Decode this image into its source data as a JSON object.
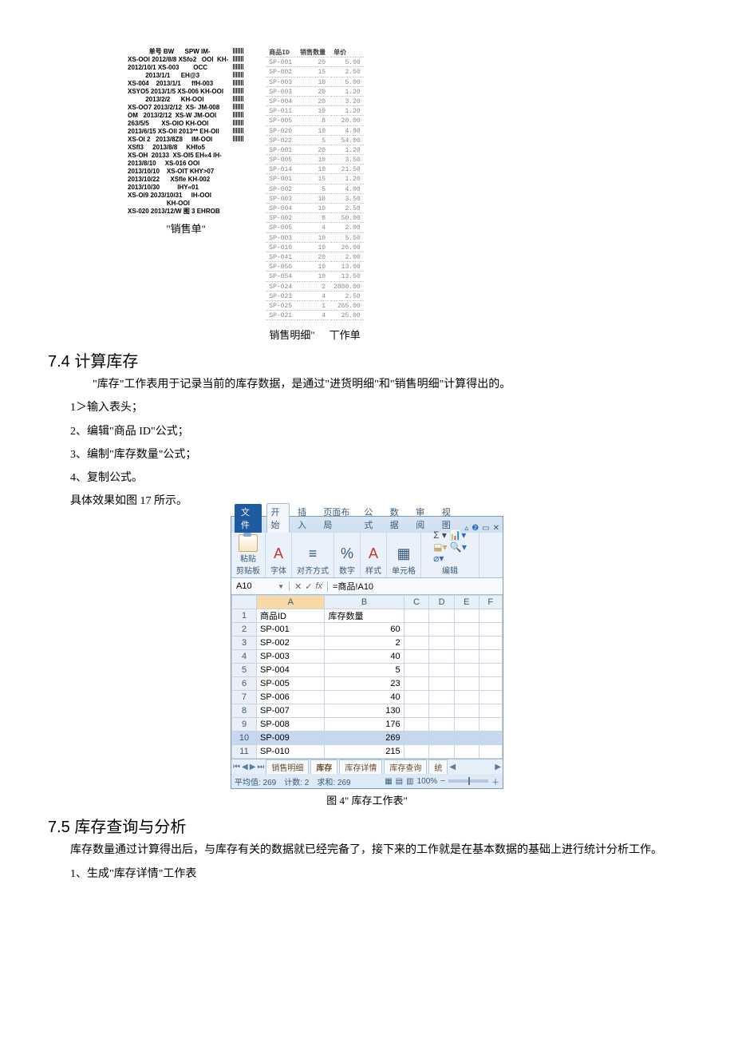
{
  "figures": {
    "sales_order_caption": "\"销售单\"",
    "sales_detail_caption": "销售明细\"",
    "t_zuodan": "丅作单",
    "sales_order_text": "            单号 BW      SPW IM-\nXS-OOl 2012/8/8 XSfo2   OOl  KH-\n2012/10/1 XS-003        OCC\n          2013/1/1      EH@3\nXS-004    2013/1/1      ffH-003\nXSYO5 2013/1/5 XS-006 KH-OOl\n          2013/2/2      KH-OOl\nXS-OO7 2013/2/12  XS- JM-008\nOM   2013/2/12  XS-W JM-OOl\n263/5/5       XS-OlO KH-OOl\n2013/6/15 XS-Oll 2013** EH-Oll\nXS-OI 2   2013/8Z8     IM-OOl\nXSfl3     2013/8/8     KHfo5\nXS-OH  20133  XS-OI5 EH«4 IH-\n2013/8/10     XS-016 OOl\n2013/10/10    XS-OIT KHY>07\n2013/10/22      XSfle KH-002\n2013/10/30          lHY«01\nXS-Ol9 20J3/10/31     IH-OOl\n                      KH-OOl\nXS-020 2013/12/W 图 3 EHROB",
    "sales_detail_header": [
      "商品ID",
      "销售数量",
      "单价"
    ],
    "sales_detail_rows": [
      [
        "SP-001",
        "20",
        "5.00"
      ],
      [
        "SP-002",
        "15",
        "2.50"
      ],
      [
        "SP-003",
        "10",
        "5.00"
      ],
      [
        "SP-003",
        "20",
        "1.20"
      ],
      [
        "SP-004",
        "20",
        "3.20"
      ],
      [
        "SP-011",
        "10",
        "1.20"
      ],
      [
        "SP-005",
        "8",
        "20.00"
      ],
      [
        "SP-020",
        "10",
        "4.80"
      ],
      [
        "SP-022",
        "5",
        "54.00"
      ],
      [
        "SP-001",
        "20",
        "1.20"
      ],
      [
        "SP-005",
        "10",
        "3.50"
      ],
      [
        "SP-014",
        "10",
        "21.50"
      ],
      [
        "SP-001",
        "15",
        "1.20"
      ],
      [
        "SP-002",
        "5",
        "4.00"
      ],
      [
        "SP-003",
        "10",
        "3.50"
      ],
      [
        "SP-004",
        "10",
        "2.50"
      ],
      [
        "SP-002",
        "8",
        "50.00"
      ],
      [
        "SP-005",
        "4",
        "2.00"
      ],
      [
        "SP-003",
        "10",
        "5.50"
      ],
      [
        "SP-010",
        "10",
        "26.00"
      ],
      [
        "SP-041",
        "20",
        "2.00"
      ],
      [
        "SP-050",
        "10",
        "13.00"
      ],
      [
        "SP-054",
        "10",
        "13.50"
      ],
      [
        "SP-024",
        "2",
        "2880.00"
      ],
      [
        "SP-023",
        "4",
        "2.50"
      ],
      [
        "SP-025",
        "1",
        "265.00"
      ],
      [
        "SP-021",
        "4",
        "25.00"
      ]
    ]
  },
  "section74": {
    "heading": "7.4 计算库存",
    "intro": "\"库存\"工作表用于记录当前的库存数据，是通过\"进货明细\"和\"销售明细\"计算得出的。",
    "steps": [
      "1＞输入表头；",
      "2、编辑\"商品 ID\"公式；",
      "3、编制\"库存数量\"公式；",
      "4、复制公式。"
    ],
    "result_line": "具体效果如图 17 所示。"
  },
  "excel": {
    "tabs": {
      "file": "文件",
      "home": "开始",
      "insert": "插入",
      "layout": "页面布局",
      "formulas": "公式",
      "data": "数据",
      "review": "审阅",
      "view": "视图"
    },
    "groups": {
      "clipboard": "剪贴板",
      "font": "字体",
      "align": "对齐方式",
      "number": "数字",
      "styles": "样式",
      "cells": "单元格",
      "editing": "编辑"
    },
    "paste_label": "粘贴",
    "namebox": "A10",
    "formula": "=商品!A10",
    "fx": "fx",
    "columns": [
      "",
      "A",
      "B",
      "C",
      "D",
      "E",
      "F"
    ],
    "header_row": [
      "商品ID",
      "库存数量"
    ],
    "rows": [
      {
        "n": "1",
        "a": "商品ID",
        "b": "库存数量"
      },
      {
        "n": "2",
        "a": "SP-001",
        "b": "60"
      },
      {
        "n": "3",
        "a": "SP-002",
        "b": "2"
      },
      {
        "n": "4",
        "a": "SP-003",
        "b": "40"
      },
      {
        "n": "5",
        "a": "SP-004",
        "b": "5"
      },
      {
        "n": "6",
        "a": "SP-005",
        "b": "23"
      },
      {
        "n": "7",
        "a": "SP-006",
        "b": "40"
      },
      {
        "n": "8",
        "a": "SP-007",
        "b": "130"
      },
      {
        "n": "9",
        "a": "SP-008",
        "b": "176"
      },
      {
        "n": "10",
        "a": "SP-009",
        "b": "269"
      },
      {
        "n": "11",
        "a": "SP-010",
        "b": "215"
      }
    ],
    "sheet_tabs": [
      "销售明细",
      "库存",
      "库存详情",
      "库存查询",
      "统"
    ],
    "status": {
      "avg": "平均值: 269",
      "count": "计数: 2",
      "sum": "求和: 269",
      "zoom": "100%"
    },
    "caption": "图 4\" 库存工作表\""
  },
  "section75": {
    "heading": "7.5 库存查询与分析",
    "para": "库存数量通过计算得出后，与库存有关的数据就已经完备了，接下来的工作就是在基本数据的基础上进行统计分析工作。",
    "item1": "1、生成\"库存详情\"工作表"
  },
  "chart_data": {
    "type": "table",
    "title": "库存工作表",
    "columns": [
      "商品ID",
      "库存数量"
    ],
    "rows": [
      [
        "SP-001",
        60
      ],
      [
        "SP-002",
        2
      ],
      [
        "SP-003",
        40
      ],
      [
        "SP-004",
        5
      ],
      [
        "SP-005",
        23
      ],
      [
        "SP-006",
        40
      ],
      [
        "SP-007",
        130
      ],
      [
        "SP-008",
        176
      ],
      [
        "SP-009",
        269
      ],
      [
        "SP-010",
        215
      ]
    ]
  }
}
